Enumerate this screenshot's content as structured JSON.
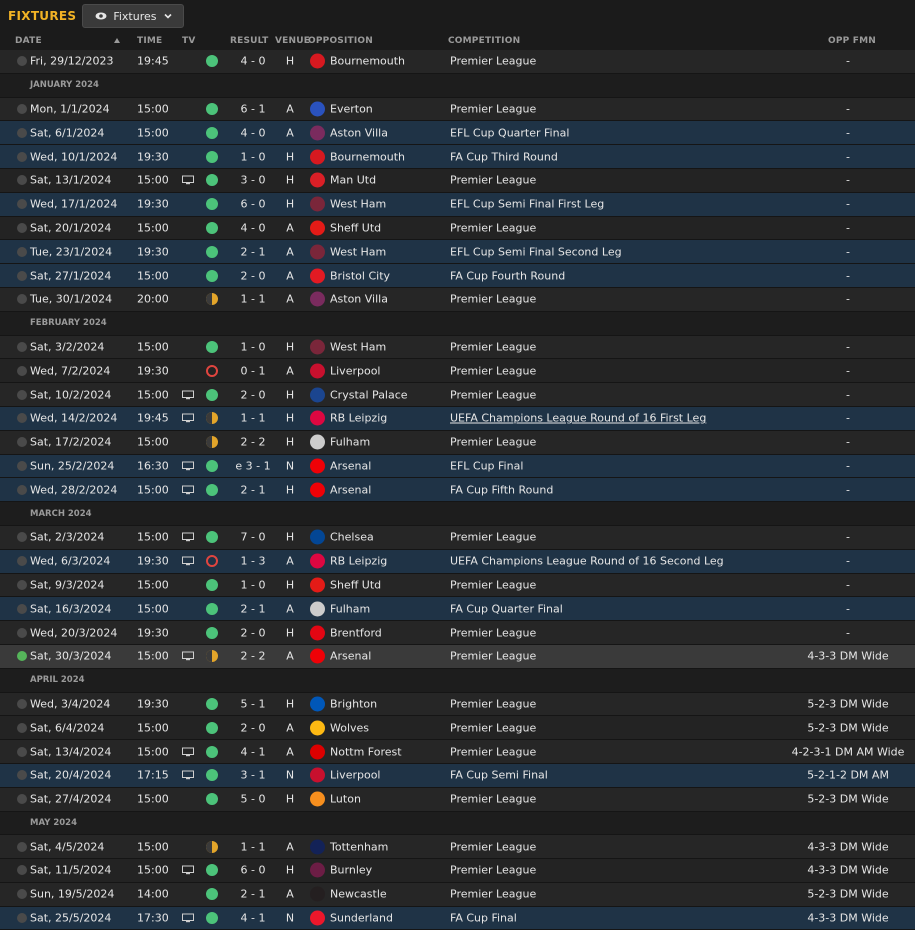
{
  "header": {
    "title": "FIXTURES",
    "view_label": "Fixtures"
  },
  "columns": {
    "date": "DATE",
    "time": "TIME",
    "tv": "TV",
    "result": "RESULT",
    "venue": "VENUE",
    "opposition": "OPPOSITION",
    "competition": "COMPETITION",
    "opp_fmn": "OPP FMN"
  },
  "colors": {
    "accent": "#f2b325",
    "win": "#4cc37a",
    "draw": "#e3a52a",
    "loss": "#e0453f",
    "cup_row": "#1f3346"
  },
  "rows": [
    {
      "type": "fixture",
      "date": "Fri, 29/12/2023",
      "time": "19:45",
      "tv": false,
      "outcome": "win",
      "score": "4 - 0",
      "venue": "H",
      "opp": "Bournemouth",
      "crest": "#d71920",
      "comp": "Premier League",
      "fmn": "-",
      "cup": false
    },
    {
      "type": "month",
      "label": "JANUARY 2024"
    },
    {
      "type": "fixture",
      "date": "Mon, 1/1/2024",
      "time": "15:00",
      "tv": false,
      "outcome": "win",
      "score": "6 - 1",
      "venue": "A",
      "opp": "Everton",
      "crest": "#2a52be",
      "comp": "Premier League",
      "fmn": "-",
      "cup": false
    },
    {
      "type": "fixture",
      "date": "Sat, 6/1/2024",
      "time": "15:00",
      "tv": false,
      "outcome": "win",
      "score": "4 - 0",
      "venue": "A",
      "opp": "Aston Villa",
      "crest": "#7a2b5e",
      "comp": "EFL Cup Quarter Final",
      "fmn": "-",
      "cup": true
    },
    {
      "type": "fixture",
      "date": "Wed, 10/1/2024",
      "time": "19:30",
      "tv": false,
      "outcome": "win",
      "score": "1 - 0",
      "venue": "H",
      "opp": "Bournemouth",
      "crest": "#d71920",
      "comp": "FA Cup Third Round",
      "fmn": "-",
      "cup": true
    },
    {
      "type": "fixture",
      "date": "Sat, 13/1/2024",
      "time": "15:00",
      "tv": true,
      "outcome": "win",
      "score": "3 - 0",
      "venue": "H",
      "opp": "Man Utd",
      "crest": "#da1f26",
      "comp": "Premier League",
      "fmn": "-",
      "cup": false
    },
    {
      "type": "fixture",
      "date": "Wed, 17/1/2024",
      "time": "19:30",
      "tv": false,
      "outcome": "win",
      "score": "6 - 0",
      "venue": "H",
      "opp": "West Ham",
      "crest": "#7a263a",
      "comp": "EFL Cup Semi Final First Leg",
      "fmn": "-",
      "cup": true
    },
    {
      "type": "fixture",
      "date": "Sat, 20/1/2024",
      "time": "15:00",
      "tv": false,
      "outcome": "win",
      "score": "4 - 0",
      "venue": "A",
      "opp": "Sheff Utd",
      "crest": "#e41b17",
      "comp": "Premier League",
      "fmn": "-",
      "cup": false
    },
    {
      "type": "fixture",
      "date": "Tue, 23/1/2024",
      "time": "19:30",
      "tv": false,
      "outcome": "win",
      "score": "2 - 1",
      "venue": "A",
      "opp": "West Ham",
      "crest": "#7a263a",
      "comp": "EFL Cup Semi Final Second Leg",
      "fmn": "-",
      "cup": true
    },
    {
      "type": "fixture",
      "date": "Sat, 27/1/2024",
      "time": "15:00",
      "tv": false,
      "outcome": "win",
      "score": "2 - 0",
      "venue": "A",
      "opp": "Bristol City",
      "crest": "#e21a23",
      "comp": "FA Cup Fourth Round",
      "fmn": "-",
      "cup": true
    },
    {
      "type": "fixture",
      "date": "Tue, 30/1/2024",
      "time": "20:00",
      "tv": false,
      "outcome": "draw",
      "score": "1 - 1",
      "venue": "A",
      "opp": "Aston Villa",
      "crest": "#7a2b5e",
      "comp": "Premier League",
      "fmn": "-",
      "cup": false
    },
    {
      "type": "month",
      "label": "FEBRUARY 2024"
    },
    {
      "type": "fixture",
      "date": "Sat, 3/2/2024",
      "time": "15:00",
      "tv": false,
      "outcome": "win",
      "score": "1 - 0",
      "venue": "H",
      "opp": "West Ham",
      "crest": "#7a263a",
      "comp": "Premier League",
      "fmn": "-",
      "cup": false
    },
    {
      "type": "fixture",
      "date": "Wed, 7/2/2024",
      "time": "19:30",
      "tv": false,
      "outcome": "loss",
      "score": "0 - 1",
      "venue": "A",
      "opp": "Liverpool",
      "crest": "#c8102e",
      "comp": "Premier League",
      "fmn": "-",
      "cup": false
    },
    {
      "type": "fixture",
      "date": "Sat, 10/2/2024",
      "time": "15:00",
      "tv": true,
      "outcome": "win",
      "score": "2 - 0",
      "venue": "H",
      "opp": "Crystal Palace",
      "crest": "#1b458f",
      "comp": "Premier League",
      "fmn": "-",
      "cup": false
    },
    {
      "type": "fixture",
      "date": "Wed, 14/2/2024",
      "time": "19:45",
      "tv": true,
      "outcome": "draw",
      "score": "1 - 1",
      "venue": "H",
      "opp": "RB Leipzig",
      "crest": "#dd0741",
      "comp": "UEFA Champions League Round of 16 First Leg",
      "fmn": "-",
      "cup": true,
      "link": true,
      "hover": true
    },
    {
      "type": "fixture",
      "date": "Sat, 17/2/2024",
      "time": "15:00",
      "tv": false,
      "outcome": "draw",
      "score": "2 - 2",
      "venue": "H",
      "opp": "Fulham",
      "crest": "#cccccc",
      "comp": "Premier League",
      "fmn": "-",
      "cup": false
    },
    {
      "type": "fixture",
      "date": "Sun, 25/2/2024",
      "time": "16:30",
      "tv": true,
      "outcome": "win",
      "score": "e 3 - 1",
      "venue": "N",
      "opp": "Arsenal",
      "crest": "#ef0107",
      "comp": "EFL Cup Final",
      "fmn": "-",
      "cup": true
    },
    {
      "type": "fixture",
      "date": "Wed, 28/2/2024",
      "time": "15:00",
      "tv": true,
      "outcome": "win",
      "score": "2 - 1",
      "venue": "H",
      "opp": "Arsenal",
      "crest": "#ef0107",
      "comp": "FA Cup Fifth Round",
      "fmn": "-",
      "cup": true
    },
    {
      "type": "month",
      "label": "MARCH 2024"
    },
    {
      "type": "fixture",
      "date": "Sat, 2/3/2024",
      "time": "15:00",
      "tv": true,
      "outcome": "win",
      "score": "7 - 0",
      "venue": "H",
      "opp": "Chelsea",
      "crest": "#034694",
      "comp": "Premier League",
      "fmn": "-",
      "cup": false
    },
    {
      "type": "fixture",
      "date": "Wed, 6/3/2024",
      "time": "19:30",
      "tv": true,
      "outcome": "loss",
      "score": "1 - 3",
      "venue": "A",
      "opp": "RB Leipzig",
      "crest": "#dd0741",
      "comp": "UEFA Champions League Round of 16 Second Leg",
      "fmn": "-",
      "cup": true
    },
    {
      "type": "fixture",
      "date": "Sat, 9/3/2024",
      "time": "15:00",
      "tv": false,
      "outcome": "win",
      "score": "1 - 0",
      "venue": "H",
      "opp": "Sheff Utd",
      "crest": "#e41b17",
      "comp": "Premier League",
      "fmn": "-",
      "cup": false
    },
    {
      "type": "fixture",
      "date": "Sat, 16/3/2024",
      "time": "15:00",
      "tv": false,
      "outcome": "win",
      "score": "2 - 1",
      "venue": "A",
      "opp": "Fulham",
      "crest": "#cccccc",
      "comp": "FA Cup Quarter Final",
      "fmn": "-",
      "cup": true
    },
    {
      "type": "fixture",
      "date": "Wed, 20/3/2024",
      "time": "19:30",
      "tv": false,
      "outcome": "win",
      "score": "2 - 0",
      "venue": "H",
      "opp": "Brentford",
      "crest": "#e30613",
      "comp": "Premier League",
      "fmn": "-",
      "cup": false
    },
    {
      "type": "fixture",
      "date": "Sat, 30/3/2024",
      "time": "15:00",
      "tv": true,
      "outcome": "draw",
      "score": "2 - 2",
      "venue": "A",
      "opp": "Arsenal",
      "crest": "#ef0107",
      "comp": "Premier League",
      "fmn": "4-3-3 DM Wide",
      "cup": false,
      "hl": true,
      "done": true
    },
    {
      "type": "month",
      "label": "APRIL 2024"
    },
    {
      "type": "fixture",
      "date": "Wed, 3/4/2024",
      "time": "19:30",
      "tv": false,
      "outcome": "win",
      "score": "5 - 1",
      "venue": "H",
      "opp": "Brighton",
      "crest": "#0057b8",
      "comp": "Premier League",
      "fmn": "5-2-3 DM Wide",
      "cup": false
    },
    {
      "type": "fixture",
      "date": "Sat, 6/4/2024",
      "time": "15:00",
      "tv": false,
      "outcome": "win",
      "score": "2 - 0",
      "venue": "A",
      "opp": "Wolves",
      "crest": "#fdb913",
      "comp": "Premier League",
      "fmn": "5-2-3 DM Wide",
      "cup": false
    },
    {
      "type": "fixture",
      "date": "Sat, 13/4/2024",
      "time": "15:00",
      "tv": true,
      "outcome": "win",
      "score": "4 - 1",
      "venue": "A",
      "opp": "Nottm Forest",
      "crest": "#dd0000",
      "comp": "Premier League",
      "fmn": "4-2-3-1 DM AM Wide",
      "cup": false
    },
    {
      "type": "fixture",
      "date": "Sat, 20/4/2024",
      "time": "17:15",
      "tv": true,
      "outcome": "win",
      "score": "3 - 1",
      "venue": "N",
      "opp": "Liverpool",
      "crest": "#c8102e",
      "comp": "FA Cup Semi Final",
      "fmn": "5-2-1-2 DM AM",
      "cup": true
    },
    {
      "type": "fixture",
      "date": "Sat, 27/4/2024",
      "time": "15:00",
      "tv": false,
      "outcome": "win",
      "score": "5 - 0",
      "venue": "H",
      "opp": "Luton",
      "crest": "#f78f1e",
      "comp": "Premier League",
      "fmn": "5-2-3 DM Wide",
      "cup": false
    },
    {
      "type": "month",
      "label": "MAY 2024"
    },
    {
      "type": "fixture",
      "date": "Sat, 4/5/2024",
      "time": "15:00",
      "tv": false,
      "outcome": "draw",
      "score": "1 - 1",
      "venue": "A",
      "opp": "Tottenham",
      "crest": "#132257",
      "comp": "Premier League",
      "fmn": "4-3-3 DM Wide",
      "cup": false
    },
    {
      "type": "fixture",
      "date": "Sat, 11/5/2024",
      "time": "15:00",
      "tv": true,
      "outcome": "win",
      "score": "6 - 0",
      "venue": "H",
      "opp": "Burnley",
      "crest": "#6c1d45",
      "comp": "Premier League",
      "fmn": "4-3-3 DM Wide",
      "cup": false
    },
    {
      "type": "fixture",
      "date": "Sun, 19/5/2024",
      "time": "14:00",
      "tv": false,
      "outcome": "win",
      "score": "2 - 1",
      "venue": "A",
      "opp": "Newcastle",
      "crest": "#241f20",
      "comp": "Premier League",
      "fmn": "5-2-3 DM Wide",
      "cup": false
    },
    {
      "type": "fixture",
      "date": "Sat, 25/5/2024",
      "time": "17:30",
      "tv": true,
      "outcome": "win",
      "score": "4 - 1",
      "venue": "N",
      "opp": "Sunderland",
      "crest": "#eb172b",
      "comp": "FA Cup Final",
      "fmn": "4-3-3 DM Wide",
      "cup": true
    }
  ]
}
